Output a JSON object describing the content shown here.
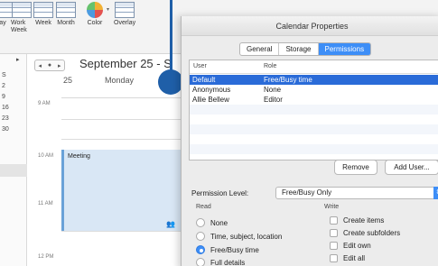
{
  "ribbon": {
    "buttons": [
      {
        "label": "ay",
        "icon": "calendar-grid-icon"
      },
      {
        "label": "Work Week",
        "icon": "work-week-icon"
      },
      {
        "label": "Week",
        "icon": "week-icon"
      },
      {
        "label": "Month",
        "icon": "month-icon"
      },
      {
        "label": "Color",
        "icon": "color-wheel-icon"
      },
      {
        "label": "Overlay",
        "icon": "overlay-icon"
      }
    ]
  },
  "minical": {
    "rows": [
      "S",
      "2",
      "9",
      "16",
      "23",
      "30"
    ],
    "nav": "▸"
  },
  "calendar": {
    "nav_prev": "◂",
    "nav_today": "●",
    "nav_next": "▸",
    "title": "September 25 - S",
    "day_number": "25",
    "day_name": "Monday",
    "hours": [
      "9 AM",
      "10 AM",
      "11 AM",
      "12 PM"
    ],
    "event": {
      "title": "Meeting",
      "icon": "attendees-icon"
    }
  },
  "dialog": {
    "title": "Calendar Properties",
    "tabs": [
      {
        "label": "General",
        "active": false
      },
      {
        "label": "Storage",
        "active": false
      },
      {
        "label": "Permissions",
        "active": true
      }
    ],
    "columns": {
      "user": "User",
      "role": "Role"
    },
    "rows": [
      {
        "user": "Default",
        "role": "Free/Busy time",
        "selected": true
      },
      {
        "user": "Anonymous",
        "role": "None",
        "selected": false
      },
      {
        "user": "Allie Bellew",
        "role": "Editor",
        "selected": false
      }
    ],
    "remove_label": "Remove",
    "add_user_label": "Add User...",
    "permission_level_label": "Permission Level:",
    "permission_level_value": "Free/Busy Only",
    "read_header": "Read",
    "write_header": "Write",
    "read_options": [
      {
        "label": "None",
        "checked": false
      },
      {
        "label": "Time, subject, location",
        "checked": false
      },
      {
        "label": "Free/Busy time",
        "checked": true
      },
      {
        "label": "Full details",
        "checked": false
      }
    ],
    "write_options": [
      {
        "label": "Create items",
        "checked": false
      },
      {
        "label": "Create subfolders",
        "checked": false
      },
      {
        "label": "Edit own",
        "checked": false
      },
      {
        "label": "Edit all",
        "checked": false
      }
    ]
  },
  "colors": {
    "accent": "#3d8ef7",
    "selection": "#2a6bd8",
    "pointer": "#1f5fa8",
    "event_fill": "#d9e7f5"
  }
}
